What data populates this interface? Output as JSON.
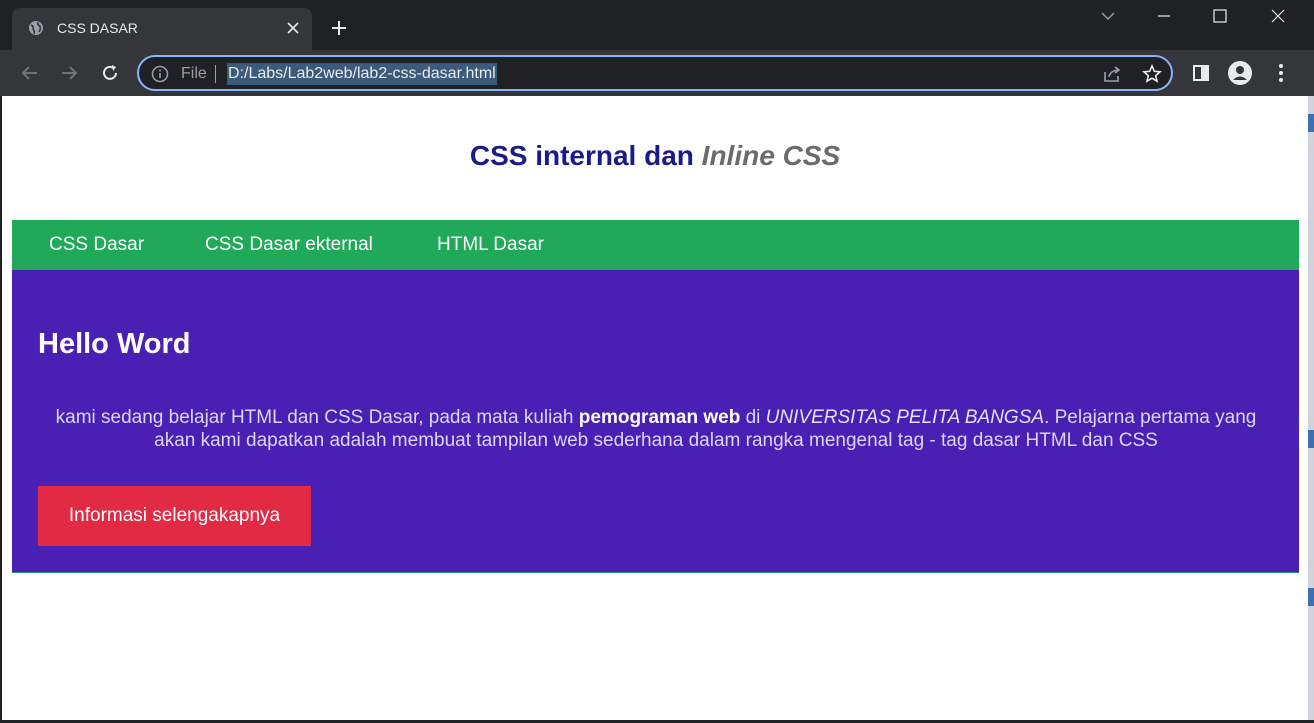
{
  "browser": {
    "tab_title": "CSS DASAR",
    "address": {
      "scheme_label": "File",
      "url": "D:/Labs/Lab2web/lab2-css-dasar.html"
    }
  },
  "page": {
    "title_prefix": "CSS internal dan ",
    "title_italic": "Inline CSS",
    "nav": [
      {
        "label": "CSS Dasar"
      },
      {
        "label": "CSS Dasar ekternal"
      },
      {
        "label": "HTML Dasar"
      }
    ],
    "hero": {
      "heading": "Hello Word",
      "text_1": "kami sedang belajar HTML dan CSS Dasar, pada mata kuliah ",
      "text_bold": "pemograman web",
      "text_2": " di ",
      "text_italic": "UNIVERSITAS PELITA BANGSA",
      "text_3": ". Pelajarna pertama yang akan kami dapatkan adalah membuat tampilan web sederhana dalam rangka mengenal tag - tag dasar HTML dan CSS",
      "button_label": "Informasi selengakapnya"
    }
  },
  "colors": {
    "chrome_dark": "#202124",
    "toolbar": "#35363a",
    "nav_green": "#21a95a",
    "hero_purple": "#4920b3",
    "button_red": "#e32a45",
    "title_blue": "#1a1a8c"
  },
  "icons": [
    "globe-icon",
    "close-icon",
    "plus-icon",
    "chevron-down-icon",
    "minimize-icon",
    "maximize-icon",
    "back-icon",
    "forward-icon",
    "reload-icon",
    "info-icon",
    "share-icon",
    "star-icon",
    "side-panel-icon",
    "profile-icon",
    "more-vert-icon"
  ]
}
